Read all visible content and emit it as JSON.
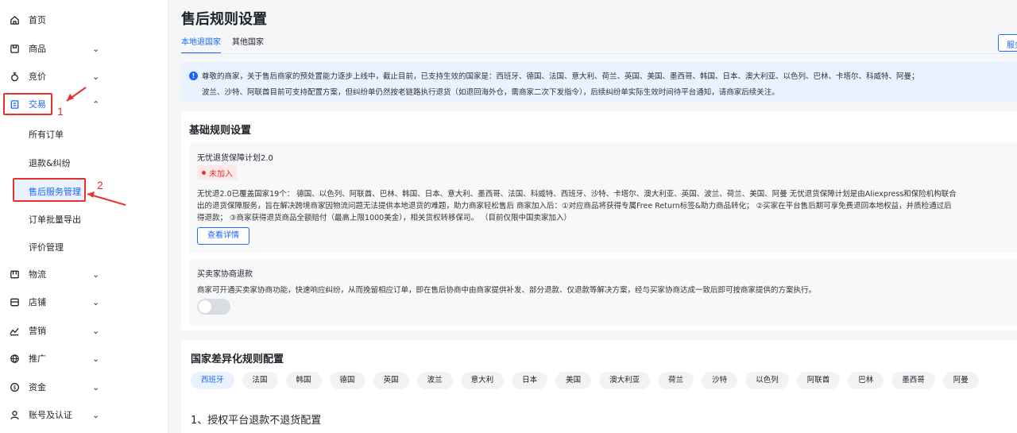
{
  "sidebar": {
    "items": [
      {
        "label": "首页",
        "icon": "home-icon",
        "has_chevron": false
      },
      {
        "label": "商品",
        "icon": "product-icon",
        "has_chevron": true,
        "chevron": "⌄"
      },
      {
        "label": "竞价",
        "icon": "bid-icon",
        "has_chevron": true,
        "chevron": "⌄"
      },
      {
        "label": "交易",
        "icon": "trade-icon",
        "has_chevron": true,
        "chevron": "⌃",
        "expanded": true
      },
      {
        "label": "物流",
        "icon": "logistics-icon",
        "has_chevron": true,
        "chevron": "⌄"
      },
      {
        "label": "店铺",
        "icon": "store-icon",
        "has_chevron": true,
        "chevron": "⌄"
      },
      {
        "label": "营销",
        "icon": "marketing-icon",
        "has_chevron": true,
        "chevron": "⌄"
      },
      {
        "label": "推广",
        "icon": "promotion-icon",
        "has_chevron": true,
        "chevron": "⌄"
      },
      {
        "label": "资金",
        "icon": "funds-icon",
        "has_chevron": true,
        "chevron": "⌄"
      },
      {
        "label": "账号及认证",
        "icon": "account-icon",
        "has_chevron": true,
        "chevron": "⌄"
      }
    ],
    "trade_sub": [
      "所有订单",
      "退款&纠纷",
      "售后服务管理",
      "订单批量导出",
      "评价管理"
    ],
    "active_sub": "售后服务管理"
  },
  "annotations": {
    "one": "1",
    "two": "2"
  },
  "main": {
    "title": "售后规则设置",
    "tabs": [
      "本地退国家",
      "其他国家"
    ],
    "corner_button": "服务",
    "notice": {
      "line1": "尊敬的商家，关于售后商家的预处置能力逐步上线中，截止目前，已支持生效的国家是：西班牙、德国、法国、意大利、荷兰、英国、美国、墨西哥、韩国、日本、澳大利亚、以色列、巴林、卡塔尔、科威特、阿曼；",
      "line2": "波兰、沙特、阿联酋目前可支持配置方案，但纠纷单仍然按老链路执行退货（如退回海外仓，需商家二次下发指令），后续纠纷单实际生效时间待平台通知，请商家后续关注。"
    },
    "basic": {
      "title": "基础规则设置",
      "plan": {
        "title": "无忧退货保障计划2.0",
        "status": "未加入",
        "desc1": "无忧退2.0已覆盖国家19个： 德国、以色列、阿联酋、巴林、韩国、日本、意大利、墨西哥、法国、科威特、西班牙、沙特、卡塔尔、澳大利亚、英国、波兰、荷兰、美国、阿曼 无忧退货保障计划是由Aliexpress和保险机构联合",
        "desc2": "出的退货保障服务，旨在解决跨境商家因物流问题无法提供本地退货的难题，助力商家轻松售后 商家加入后：①对应商品将获得专属Free Return标签&助力商品转化； ②买家在平台售后期可享免费退回本地权益，并质检通过后",
        "desc3": "得退款； ③商家获得退货商品全额赔付（最高上限1000美金），相关货权转移保司。 （目前仅限中国卖家加入）",
        "button": "查看详情"
      },
      "negotiate": {
        "title": "买卖家协商退款",
        "desc": "商家可开通买卖家协商功能，快速响应纠纷，从而挽留相应订单，即在售后协商中由商家提供补发、部分退款、仅退款等解决方案，经与买家协商达成一致后即可按商家提供的方案执行。",
        "toggle_on": false
      }
    },
    "country": {
      "title": "国家差异化规则配置",
      "chips": [
        "西班牙",
        "法国",
        "韩国",
        "德国",
        "英国",
        "波兰",
        "意大利",
        "日本",
        "美国",
        "澳大利亚",
        "荷兰",
        "沙特",
        "以色列",
        "阿联酋",
        "巴林",
        "墨西哥",
        "阿曼"
      ],
      "active_chip": "西班牙",
      "sub_heading": "1、授权平台退款不退货配置"
    }
  },
  "colors": {
    "accent": "#1a66ff",
    "annotation_red": "#e6322d",
    "bg": "#f5f6f8"
  }
}
